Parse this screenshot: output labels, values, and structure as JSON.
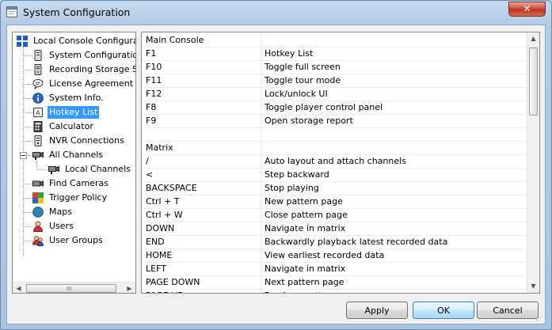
{
  "window": {
    "title": "System Configuration",
    "close_glyph": "✕"
  },
  "tree": {
    "items": [
      {
        "label": "Local Console Configuration",
        "icon": "local-console-icon",
        "depth": 0,
        "selected": false
      },
      {
        "label": "System Configuration",
        "icon": "system-config-icon",
        "depth": 1,
        "selected": false
      },
      {
        "label": "Recording Storage Settings",
        "icon": "storage-icon",
        "depth": 1,
        "selected": false
      },
      {
        "label": "License Agreement",
        "icon": "license-icon",
        "depth": 1,
        "selected": false
      },
      {
        "label": "System Info.",
        "icon": "info-icon",
        "depth": 1,
        "selected": false
      },
      {
        "label": "Hotkey List",
        "icon": "hotkey-icon",
        "depth": 1,
        "selected": true
      },
      {
        "label": "Calculator",
        "icon": "calculator-icon",
        "depth": 1,
        "selected": false
      },
      {
        "label": "NVR Connections",
        "icon": "nvr-icon",
        "depth": 1,
        "selected": false
      },
      {
        "label": "All Channels",
        "icon": "camera-icon",
        "depth": 1,
        "selected": false
      },
      {
        "label": "Local Channels",
        "icon": "camera-icon",
        "depth": 2,
        "selected": false
      },
      {
        "label": "Find Cameras",
        "icon": "find-camera-icon",
        "depth": 1,
        "selected": false
      },
      {
        "label": "Trigger Policy",
        "icon": "trigger-policy-icon",
        "depth": 1,
        "selected": false
      },
      {
        "label": "Maps",
        "icon": "globe-icon",
        "depth": 1,
        "selected": false
      },
      {
        "label": "Users",
        "icon": "user-icon",
        "depth": 1,
        "selected": false
      },
      {
        "label": "User Groups",
        "icon": "user-group-icon",
        "depth": 1,
        "selected": false
      }
    ],
    "hscroll_grip": "III"
  },
  "hotkeys": {
    "rows": [
      {
        "key": "Main Console",
        "action": ""
      },
      {
        "key": "F1",
        "action": "Hotkey List"
      },
      {
        "key": "F10",
        "action": "Toggle full screen"
      },
      {
        "key": "F11",
        "action": "Toggle tour mode"
      },
      {
        "key": "F12",
        "action": "Lock/unlock UI"
      },
      {
        "key": "F8",
        "action": "Toggle player control panel"
      },
      {
        "key": "F9",
        "action": "Open storage report"
      },
      {
        "key": "",
        "action": ""
      },
      {
        "key": "Matrix",
        "action": ""
      },
      {
        "key": "/",
        "action": "Auto layout and attach channels"
      },
      {
        "key": "<",
        "action": "Step backward"
      },
      {
        "key": "BACKSPACE",
        "action": "Stop playing"
      },
      {
        "key": "Ctrl + T",
        "action": "New pattern page"
      },
      {
        "key": "Ctrl + W",
        "action": "Close pattern page"
      },
      {
        "key": "DOWN",
        "action": "Navigate in matrix"
      },
      {
        "key": "END",
        "action": "Backwardly playback latest recorded data"
      },
      {
        "key": "HOME",
        "action": "View earliest recorded data"
      },
      {
        "key": "LEFT",
        "action": "Navigate in matrix"
      },
      {
        "key": "PAGE DOWN",
        "action": "Next pattern page"
      },
      {
        "key": "PAGE UP",
        "action": "Previous pattern page"
      }
    ]
  },
  "buttons": {
    "apply": "Apply",
    "ok": "OK",
    "cancel": "Cancel"
  },
  "colors": {
    "selection": "#3399ff",
    "close": "#c7452d",
    "default_button": "#3c7fb1"
  }
}
